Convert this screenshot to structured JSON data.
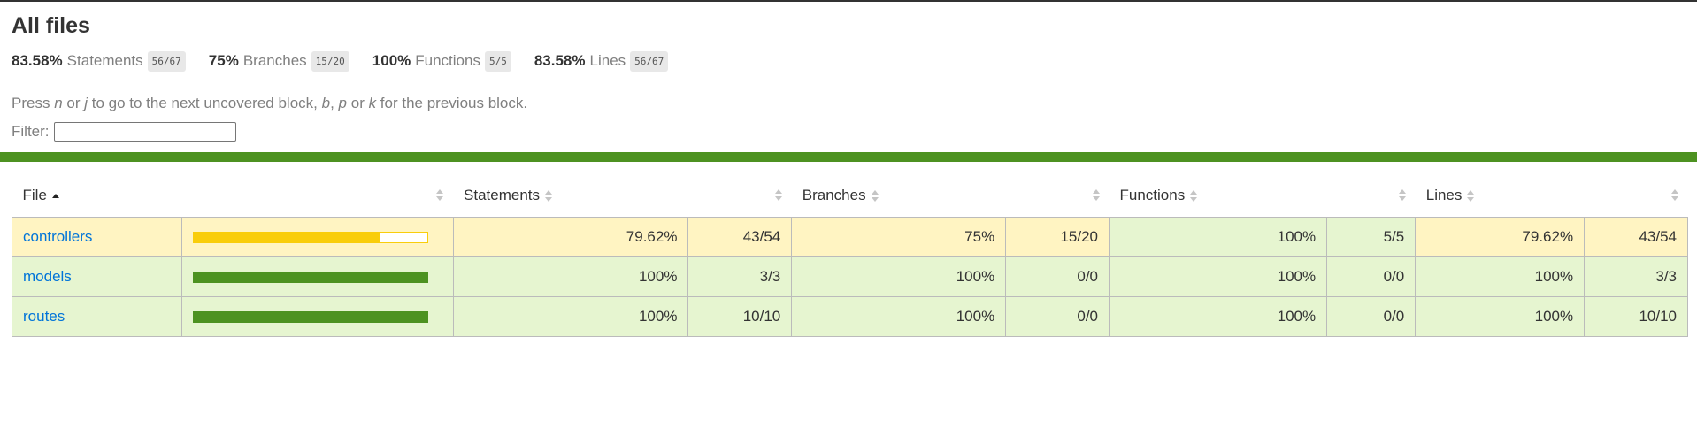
{
  "title": "All files",
  "summary": [
    {
      "pct": "83.58%",
      "label": "Statements",
      "fraction": "56/67"
    },
    {
      "pct": "75%",
      "label": "Branches",
      "fraction": "15/20"
    },
    {
      "pct": "100%",
      "label": "Functions",
      "fraction": "5/5"
    },
    {
      "pct": "83.58%",
      "label": "Lines",
      "fraction": "56/67"
    }
  ],
  "hint": {
    "prefix": "Press ",
    "key1": "n",
    "or1": " or ",
    "key2": "j",
    "mid": " to go to the next uncovered block, ",
    "key3": "b",
    "sep": ", ",
    "key4": "p",
    "or2": " or ",
    "key5": "k",
    "suffix": " for the previous block."
  },
  "filter": {
    "label": "Filter:",
    "value": ""
  },
  "colors": {
    "high": "#4d9221",
    "medium": "#f9cd0b",
    "medium_bg": "#fff4c2",
    "high_bg": "#e6f5d0",
    "link": "#0074d9"
  },
  "table": {
    "headers": {
      "file": "File",
      "statements": "Statements",
      "branches": "Branches",
      "functions": "Functions",
      "lines": "Lines"
    },
    "rows": [
      {
        "file": "controllers",
        "level": "medium",
        "coverage": 0.7962,
        "stmt_pct": "79.62%",
        "stmt_frac": "43/54",
        "br_pct": "75%",
        "br_frac": "15/20",
        "fn_pct": "100%",
        "fn_frac": "5/5",
        "ln_pct": "79.62%",
        "ln_frac": "43/54"
      },
      {
        "file": "models",
        "level": "high",
        "coverage": 1.0,
        "stmt_pct": "100%",
        "stmt_frac": "3/3",
        "br_pct": "100%",
        "br_frac": "0/0",
        "fn_pct": "100%",
        "fn_frac": "0/0",
        "ln_pct": "100%",
        "ln_frac": "3/3"
      },
      {
        "file": "routes",
        "level": "high",
        "coverage": 1.0,
        "stmt_pct": "100%",
        "stmt_frac": "10/10",
        "br_pct": "100%",
        "br_frac": "0/0",
        "fn_pct": "100%",
        "fn_frac": "0/0",
        "ln_pct": "100%",
        "ln_frac": "10/10"
      }
    ]
  }
}
